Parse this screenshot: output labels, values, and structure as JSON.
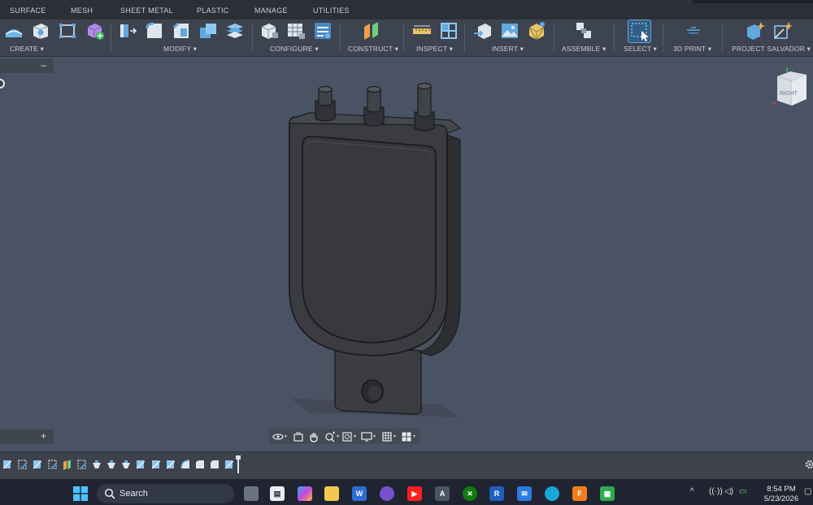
{
  "tabs": [
    "SURFACE",
    "MESH",
    "SHEET METAL",
    "PLASTIC",
    "MANAGE",
    "UTILITIES"
  ],
  "groups": {
    "create": "CREATE",
    "modify": "MODIFY",
    "configure": "CONFIGURE",
    "construct": "CONSTRUCT",
    "inspect": "INSPECT",
    "insert": "INSERT",
    "assemble": "ASSEMBLE",
    "select": "SELECT",
    "print3d": "3D PRINT",
    "project": "PROJECT SALVADOR"
  },
  "panels": {
    "browser_toggle": "–",
    "comments_toggle": "+"
  },
  "viewcube": {
    "face_label": "RIGHT"
  },
  "taskbar": {
    "search_label": "Search",
    "time": "8:54 PM",
    "date": "5/23/2026"
  },
  "colors": {
    "canvas": "#4a5363",
    "ribbon": "#3e4350",
    "model": "#3a3c40",
    "select_accent": "#5ea7de"
  }
}
